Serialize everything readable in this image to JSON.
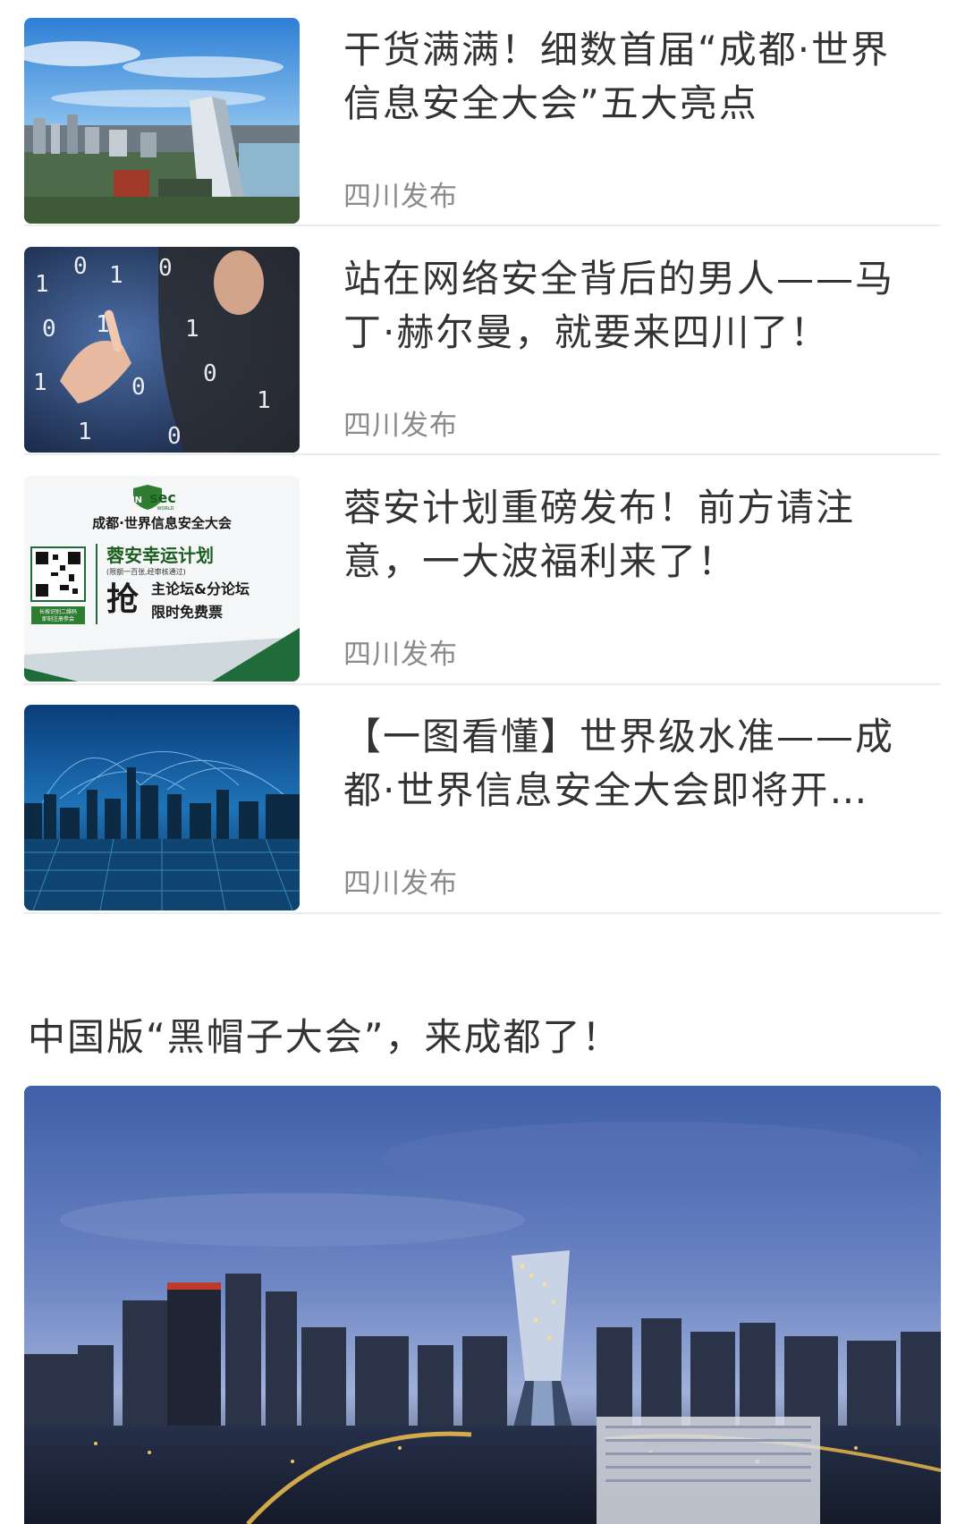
{
  "feed": {
    "articles": [
      {
        "title": "干货满满！细数首届“成都·世界信息安全大会”五大亮点",
        "source": "四川发布",
        "thumbnail": "city-skyline-photo"
      },
      {
        "title": "站在网络安全背后的男人——马丁·赫尔曼，就要来四川了！",
        "source": "四川发布",
        "thumbnail": "binary-code-hand-photo"
      },
      {
        "title": "蓉安计划重磅发布！前方请注意，一大波福利来了！",
        "source": "四川发布",
        "thumbnail": "insec-promo-poster"
      },
      {
        "title": "【一图看懂】世界级水准——成都·世界信息安全大会即将开…",
        "source": "四川发布",
        "thumbnail": "network-city-night-photo"
      }
    ],
    "featured": {
      "title": "中国版“黑帽子大会”，来成都了！",
      "image": "chengdu-night-skyline-photo"
    },
    "poster": {
      "logo_text": "sec",
      "logo_badge": "IN",
      "logo_sub": "WORLD",
      "headline": "成都·世界信息安全大会",
      "plan_title": "蓉安幸运计划",
      "plan_note": "(限额一百张,经审核通过)",
      "grab": "抢",
      "offer_line1": "主论坛&分论坛",
      "offer_line2": "限时免费票",
      "qr_caption1": "长按识别二维码",
      "qr_caption2": "即刻注册参会"
    },
    "colors": {
      "text_primary": "#333333",
      "text_secondary": "#8a8a8a",
      "divider": "#ececec",
      "poster_green": "#2e7d32"
    }
  }
}
